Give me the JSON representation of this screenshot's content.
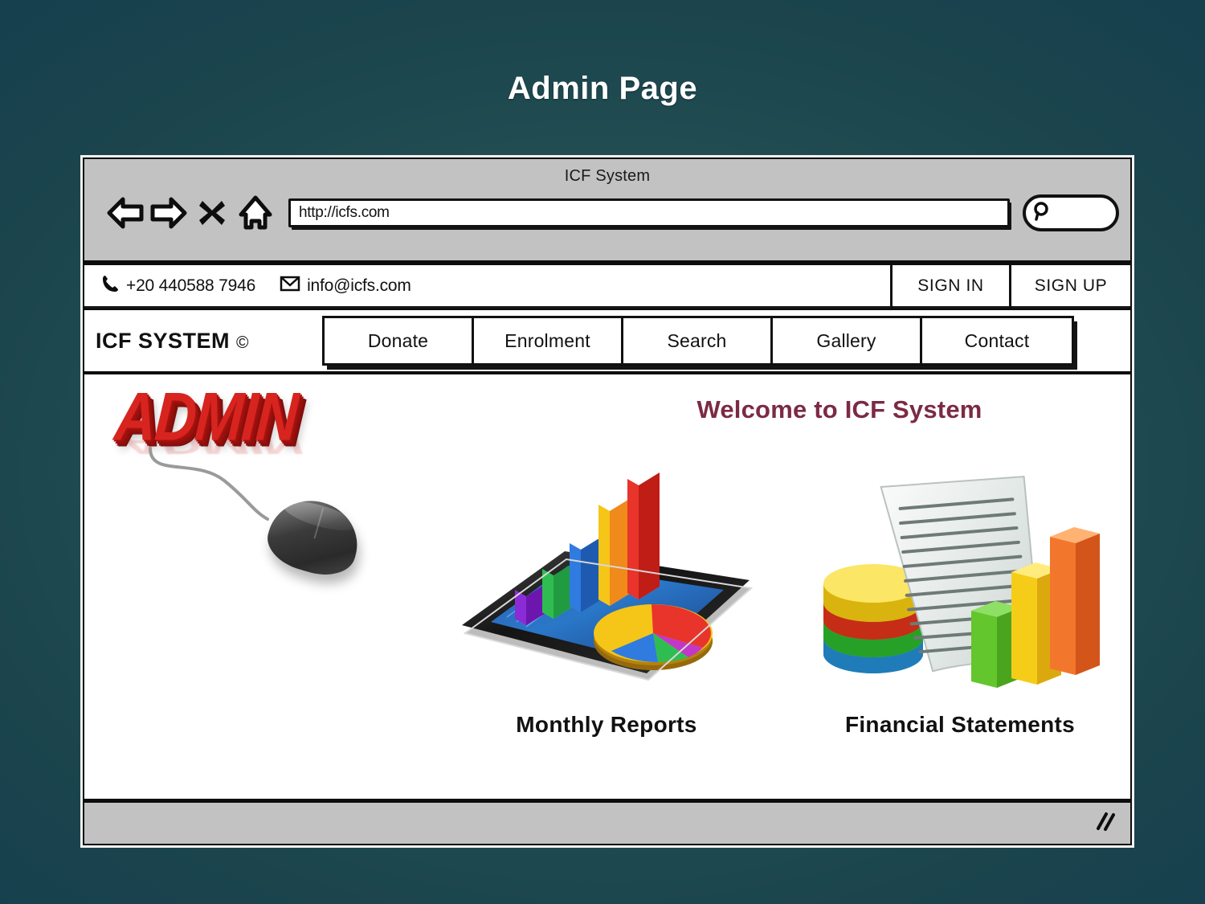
{
  "slide": {
    "title": "Admin Page",
    "background_color_outer": "#143d4f",
    "background_color_inner": "#2b595c"
  },
  "browser": {
    "window_title": "ICF System",
    "toolbar": {
      "back_icon": "back-arrow-icon",
      "forward_icon": "forward-arrow-icon",
      "stop_icon": "close-x-icon",
      "home_icon": "home-icon",
      "url_value": "http://icfs.com",
      "url_placeholder": "http://",
      "search_icon": "magnifier-icon",
      "search_value": "",
      "search_placeholder": ""
    },
    "statusbar": {
      "resize_grip_icon": "resize-grip-icon"
    }
  },
  "contact_bar": {
    "phone_icon": "phone-icon",
    "phone": "+20 440588 7946",
    "email_icon": "envelope-icon",
    "email": "info@icfs.com",
    "sign_in_label": "SIGN IN",
    "sign_up_label": "SIGN UP"
  },
  "site_nav": {
    "logo_text": "ICF SYSTEM",
    "logo_copyright": "©",
    "items": [
      {
        "label": "Donate"
      },
      {
        "label": "Enrolment"
      },
      {
        "label": "Search"
      },
      {
        "label": "Gallery"
      },
      {
        "label": "Contact"
      }
    ]
  },
  "page": {
    "welcome_heading": "Welcome to ICF System",
    "welcome_color": "#7c2a44",
    "admin_hero": {
      "word": "ADMIN",
      "color": "#d7241f",
      "mouse_icon": "computer-mouse-icon"
    },
    "cards": [
      {
        "caption": "Monthly Reports",
        "art": "tablet-3d-bar-and-pie-chart-icon"
      },
      {
        "caption": "Financial Statements",
        "art": "stacked-disk-document-bar-chart-icon"
      }
    ]
  },
  "chart_data": [
    {
      "type": "bar",
      "title": "Monthly Reports",
      "categories": [
        "1",
        "2",
        "3",
        "4",
        "5"
      ],
      "values": [
        18,
        28,
        44,
        66,
        92
      ],
      "colors": [
        "#8b2bd6",
        "#2fbd52",
        "#2f7be0",
        "#f5c518",
        "#e8342a"
      ],
      "xlabel": "",
      "ylabel": "",
      "ylim": [
        0,
        100
      ],
      "grid": false,
      "legend": "none"
    },
    {
      "type": "pie",
      "title": "Monthly Reports",
      "labels": [
        "Red",
        "Magenta",
        "Green",
        "Blue",
        "Yellow"
      ],
      "values": [
        33,
        11,
        14,
        20,
        22
      ],
      "colors": [
        "#e8342a",
        "#c236c8",
        "#2fbd52",
        "#2f7be0",
        "#f5c518"
      ],
      "legend": "none"
    },
    {
      "type": "bar",
      "title": "Financial Statements",
      "categories": [
        "1",
        "2",
        "3"
      ],
      "values": [
        42,
        70,
        95
      ],
      "colors": [
        "#63c62c",
        "#f5cd19",
        "#f2762c"
      ],
      "xlabel": "",
      "ylabel": "",
      "ylim": [
        0,
        100
      ],
      "grid": false,
      "legend": "none"
    },
    {
      "type": "bar",
      "title": "Financial Statements Data Stack",
      "categories": [
        "Yellow",
        "Red",
        "Green",
        "Blue"
      ],
      "values": [
        25,
        25,
        25,
        25
      ],
      "colors": [
        "#f6d41a",
        "#ea3c22",
        "#33c133",
        "#2d9fe0"
      ],
      "xlabel": "",
      "ylabel": "",
      "ylim": [
        0,
        100
      ],
      "grid": false,
      "legend": "none"
    }
  ]
}
